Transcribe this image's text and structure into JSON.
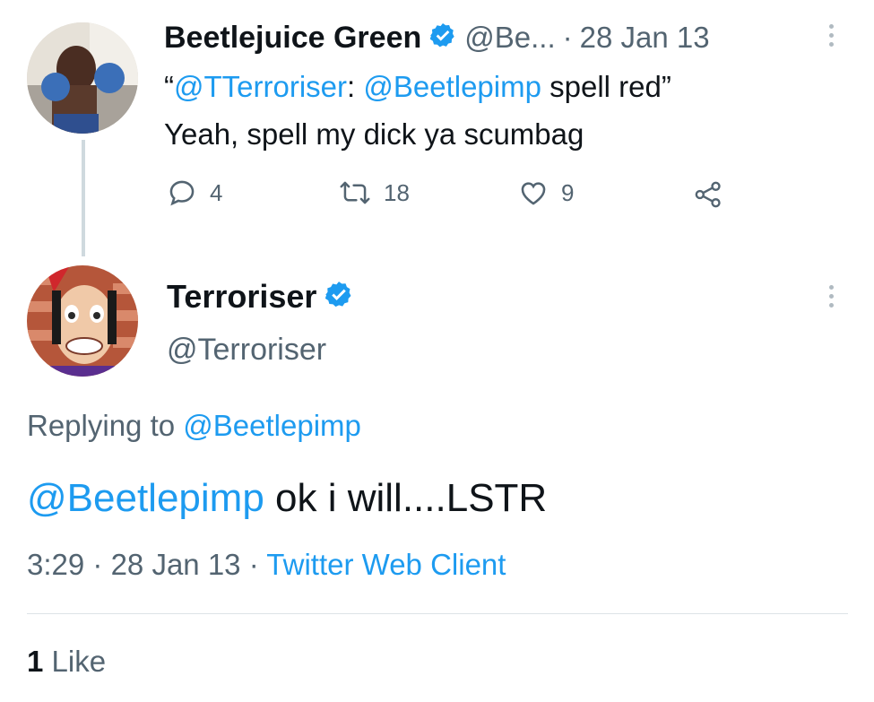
{
  "tweet1": {
    "name": "Beetlejuice Green",
    "handle": "@Be...",
    "separator": "·",
    "date": "28 Jan 13",
    "quote_open": "“",
    "mention1": "@TTerroriser",
    "colon": ":",
    "mention2": "@Beetlepimp",
    "quoted_text": "spell red",
    "quote_close": "”",
    "line2": "Yeah, spell my dick ya scumbag",
    "replies": "4",
    "retweets": "18",
    "likes": "9"
  },
  "tweet2": {
    "name": "Terroriser",
    "handle": "@Terroriser",
    "replying_prefix": "Replying to",
    "replying_handle": "@Beetlepimp",
    "mention": "@Beetlepimp",
    "body": "ok i will....LSTR",
    "time": "3:29",
    "sep1": "·",
    "date": "28 Jan 13",
    "sep2": "·",
    "client": "Twitter Web Client",
    "like_count": "1",
    "like_label": "Like"
  },
  "colors": {
    "accent": "#1d9bf0",
    "text": "#0f1419",
    "secondary": "#536471",
    "divider": "#dde3e7"
  },
  "icons": [
    "verified-badge-icon",
    "reply-icon",
    "retweet-icon",
    "like-icon",
    "share-icon",
    "more-icon"
  ]
}
